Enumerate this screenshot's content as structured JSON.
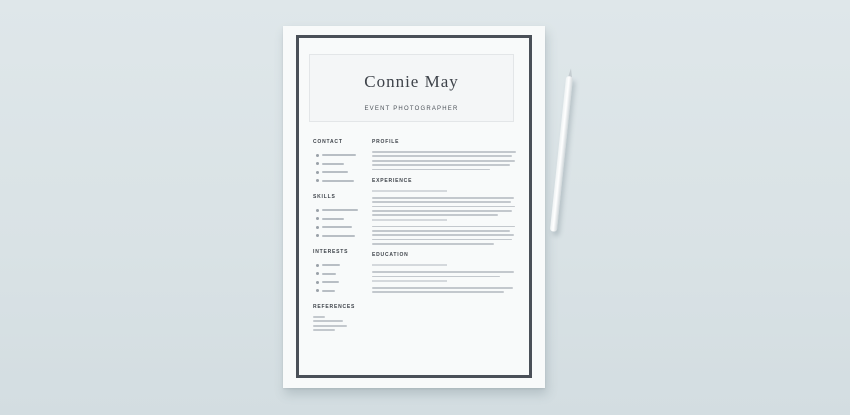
{
  "resume": {
    "name": "Connie May",
    "title": "EVENT PHOTOGRAPHER",
    "left_sections": {
      "contact": "CONTACT",
      "skills": "SKILLS",
      "interests": "INTERESTS",
      "references": "REFERENCES"
    },
    "right_sections": {
      "profile": "PROFILE",
      "experience": "EXPERIENCE",
      "education": "EDUCATION"
    }
  },
  "colors": {
    "background": "#dce4e7",
    "paper": "#f8fafa",
    "frame": "#4a5058",
    "text": "#3e434a",
    "placeholder_line": "#c3c8cd"
  },
  "objects": {
    "pen": "stylus-pen"
  }
}
